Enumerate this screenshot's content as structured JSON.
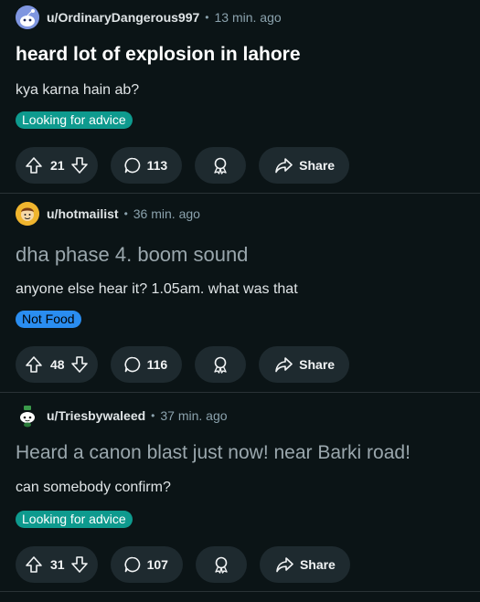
{
  "posts": [
    {
      "username": "u/OrdinaryDangerous997",
      "separator": "•",
      "time": "13 min. ago",
      "title": "heard lot of explosion in lahore",
      "body": "kya karna hain ab?",
      "flair": {
        "label": "Looking for advice",
        "bg": "#0e9a8e",
        "fg": "#ffffff"
      },
      "upvotes": "21",
      "comments": "113",
      "share_label": "Share",
      "avatar_icon": "reddit-snoo-blue-icon"
    },
    {
      "username": "u/hotmailist",
      "separator": "•",
      "time": "36 min. ago",
      "title": "dha phase 4. boom sound",
      "body": "anyone else hear it? 1.05am. what was that",
      "flair": {
        "label": "Not Food",
        "bg": "#2a8df0",
        "fg": "#000000"
      },
      "upvotes": "48",
      "comments": "116",
      "share_label": "Share",
      "avatar_icon": "reddit-snoo-yellow-icon"
    },
    {
      "username": "u/Triesbywaleed",
      "separator": "•",
      "time": "37 min. ago",
      "title": "Heard a canon blast just now! near Barki road!",
      "body": "can somebody confirm?",
      "flair": {
        "label": "Looking for advice",
        "bg": "#0e9a8e",
        "fg": "#ffffff"
      },
      "upvotes": "31",
      "comments": "107",
      "share_label": "Share",
      "avatar_icon": "reddit-snoo-green-icon"
    }
  ]
}
